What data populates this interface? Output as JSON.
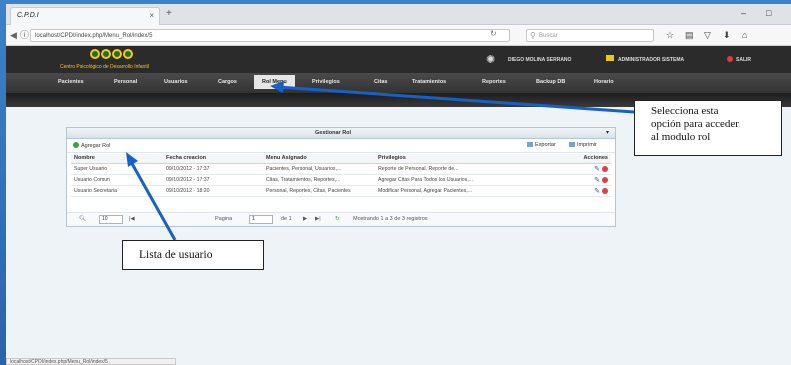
{
  "browser": {
    "tab_title": "C.P.D.I",
    "tab_close": "×",
    "new_tab": "+",
    "url": "localhost/CPDI/index.php/Menu_Rol/index/5",
    "search_placeholder": "Buscar",
    "minimize": "–",
    "maximize": "□",
    "status_url": "localhost/CPDI/index.php/Menu_Rol/index/5"
  },
  "header": {
    "logo_subtitle": "Centro Psicológico de Desarrollo Infantil",
    "user": "DIEGO MOLINA SERRANO",
    "role": "ADMINISTRADOR SISTEMA",
    "exit": "SALIR"
  },
  "menu": {
    "items": [
      "Pacientes",
      "Personal",
      "Usuarios",
      "Cargos",
      "Rol Menu",
      "Privilegios",
      "Citas",
      "Tratamientos",
      "Reportes",
      "Backup DB",
      "Horario"
    ],
    "active_index": 4
  },
  "panel": {
    "title": "Gestionar Rol",
    "collapse": "▾",
    "add_button": "Agregar Rol",
    "export_button": "Exportar",
    "print_button": "Imprimir",
    "columns": [
      "Nombre",
      "Fecha creacion",
      "Menu Asignado",
      "Privilegios",
      "Acciones"
    ],
    "rows": [
      {
        "nombre": "Super Usuario",
        "fecha": "09/10/2012 - 17:37",
        "menu": "Pacientes, Personal, Usuarios,...",
        "privilegios": "Reporte de Personal, Reporte de..."
      },
      {
        "nombre": "Usuario Comun",
        "fecha": "09/10/2012 - 17:37",
        "menu": "Citas, Tratamientos, Reportes,...",
        "privilegios": "Agregar Citas Para Todos los Usuarios,..."
      },
      {
        "nombre": "Usuario Secretaria",
        "fecha": "09/10/2012 - 18:20",
        "menu": "Personal, Reportes, Citas, Pacientes",
        "privilegios": "Modificar Personal, Agregar Pacientes,..."
      }
    ],
    "pager": {
      "page_size": "10",
      "page_label": "Pagina",
      "page_value": "1",
      "of_label": "de 1",
      "summary": "Mostrando 1 a 3 de 3 registros"
    }
  },
  "callouts": {
    "rol": [
      "Selecciona esta",
      "opción para acceder",
      "al modulo rol"
    ],
    "usuarios": "Lista de usuario"
  },
  "colors": {
    "accent_blue": "#2260b0",
    "logo_gold": "#f3c91b",
    "delete_red": "#e04040",
    "add_green": "#3aa53a"
  }
}
